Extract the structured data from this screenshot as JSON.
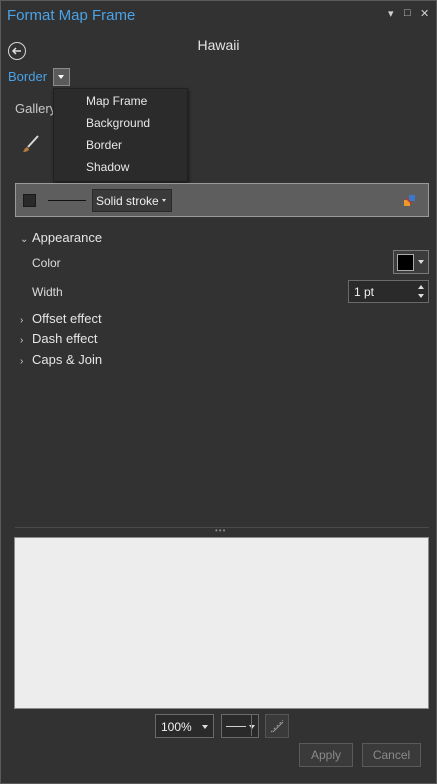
{
  "window": {
    "title": "Format Map Frame",
    "controls": [
      "▾",
      "□",
      "✕"
    ]
  },
  "panel": {
    "heading": "Hawaii"
  },
  "mode": {
    "label": "Border"
  },
  "menu": {
    "items": [
      "Map Frame",
      "Background",
      "Border",
      "Shadow"
    ]
  },
  "tabs": {
    "gallery": "Gallery"
  },
  "stroke": {
    "type": "Solid stroke"
  },
  "appearance": {
    "title": "Appearance",
    "color_label": "Color",
    "color_value": "#000000",
    "width_label": "Width",
    "width_value": "1 pt"
  },
  "sections": {
    "offset": "Offset effect",
    "dash": "Dash effect",
    "caps": "Caps & Join"
  },
  "footer": {
    "zoom": "100%",
    "apply": "Apply",
    "cancel": "Cancel"
  },
  "colors": {
    "accent": "#4aa3e8",
    "panel_bg": "#323232",
    "preview_bg": "#ededed"
  }
}
